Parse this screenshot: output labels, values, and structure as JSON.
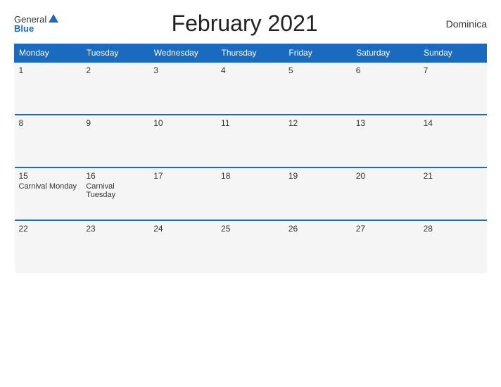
{
  "header": {
    "title": "February 2021",
    "country": "Dominica",
    "logo_general": "General",
    "logo_blue": "Blue"
  },
  "weekdays": [
    "Monday",
    "Tuesday",
    "Wednesday",
    "Thursday",
    "Friday",
    "Saturday",
    "Sunday"
  ],
  "weeks": [
    [
      {
        "day": "1",
        "events": []
      },
      {
        "day": "2",
        "events": []
      },
      {
        "day": "3",
        "events": []
      },
      {
        "day": "4",
        "events": []
      },
      {
        "day": "5",
        "events": []
      },
      {
        "day": "6",
        "events": []
      },
      {
        "day": "7",
        "events": []
      }
    ],
    [
      {
        "day": "8",
        "events": []
      },
      {
        "day": "9",
        "events": []
      },
      {
        "day": "10",
        "events": []
      },
      {
        "day": "11",
        "events": []
      },
      {
        "day": "12",
        "events": []
      },
      {
        "day": "13",
        "events": []
      },
      {
        "day": "14",
        "events": []
      }
    ],
    [
      {
        "day": "15",
        "events": [
          "Carnival Monday"
        ]
      },
      {
        "day": "16",
        "events": [
          "Carnival Tuesday"
        ]
      },
      {
        "day": "17",
        "events": []
      },
      {
        "day": "18",
        "events": []
      },
      {
        "day": "19",
        "events": []
      },
      {
        "day": "20",
        "events": []
      },
      {
        "day": "21",
        "events": []
      }
    ],
    [
      {
        "day": "22",
        "events": []
      },
      {
        "day": "23",
        "events": []
      },
      {
        "day": "24",
        "events": []
      },
      {
        "day": "25",
        "events": []
      },
      {
        "day": "26",
        "events": []
      },
      {
        "day": "27",
        "events": []
      },
      {
        "day": "28",
        "events": []
      }
    ]
  ]
}
